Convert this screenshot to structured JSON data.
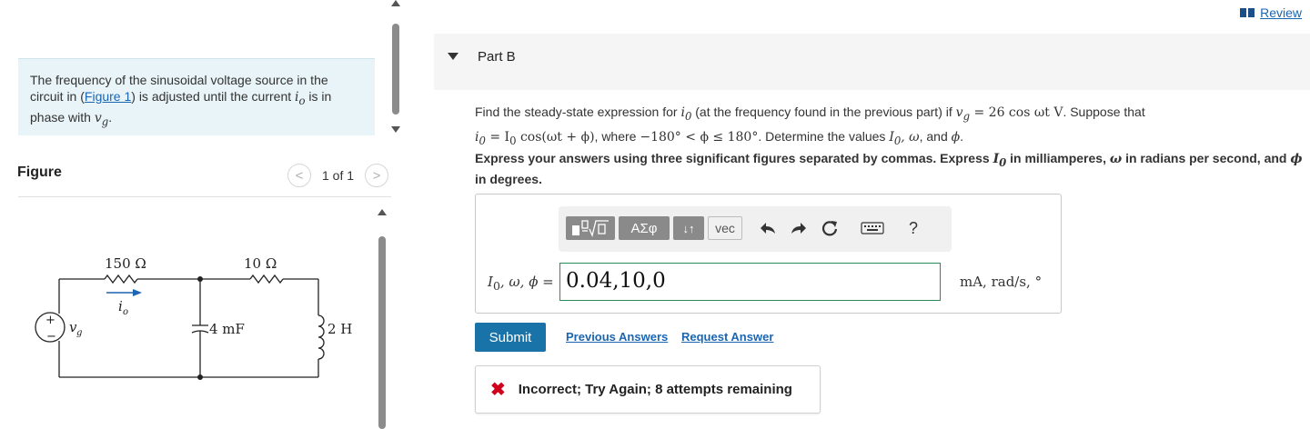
{
  "problem": {
    "text_before_link": "The frequency of the sinusoidal voltage source in the circuit in (",
    "link": "Figure 1",
    "text_after_link": ") is adjusted until the current ",
    "current_var": "i",
    "current_sub": "o",
    "text_mid": " is in phase with ",
    "voltage_var": "v",
    "voltage_sub": "g",
    "text_end": "."
  },
  "figure": {
    "title": "Figure",
    "pager_text": "1 of 1",
    "prev_glyph": "<",
    "next_glyph": ">",
    "circuit": {
      "r1": "150 Ω",
      "r2": "10 Ω",
      "capacitor": "4 mF",
      "inductor": "2 H",
      "current": "i",
      "current_sub": "o",
      "source": "v",
      "source_sub": "g",
      "plus": "+",
      "minus": "−"
    }
  },
  "review": {
    "label": "Review"
  },
  "part": {
    "title": "Part B"
  },
  "question": {
    "t1": "Find the steady-state expression for ",
    "io": "i",
    "io_sub": "0",
    "t2": " (at the frequency found in the previous part) if ",
    "vg_eq": "v",
    "vg_sub": "g",
    "vg_rhs": " = 26 cos ωt V",
    "t3": ". Suppose that",
    "line2_lhs": "i",
    "line2_lhs_sub": "0",
    "line2_rhs": " = I",
    "line2_rhs_sub": "0",
    "line2_rest": " cos(ωt + ϕ)",
    "t4": ", where ",
    "range": "−180° < ϕ ≤ 180°",
    "t5": ". Determine the values ",
    "vals": "I",
    "vals_sub": "0",
    "vals_rest": ", ω",
    "t6": ", and ",
    "phi": "ϕ",
    "t7": "."
  },
  "instructions": {
    "t1": "Express your answers using three significant figures separated by commas. Express ",
    "I0": "I",
    "I0_sub": "0",
    "t2": " in milliamperes, ",
    "omega": "ω",
    "t3": " in radians per second, and ",
    "phi": "ϕ",
    "t4": " in degrees."
  },
  "answer": {
    "label": "I",
    "label_sub": "0",
    "label_rest": ", ω, ϕ =",
    "value": "0.04,10,0",
    "units": "mA, rad/s, °"
  },
  "toolbar": {
    "greek_label": "ΑΣφ",
    "arrows_label": "↓↑",
    "vec_label": "vec",
    "help_label": "?"
  },
  "actions": {
    "submit": "Submit",
    "previous_answers": "Previous Answers",
    "request_answer": "Request Answer"
  },
  "feedback": {
    "icon": "✖",
    "message": "Incorrect; Try Again; 8 attempts remaining"
  },
  "colors": {
    "accent": "#1a73a8",
    "link": "#1a66b3",
    "error": "#d0021b",
    "problem_bg": "#e8f4f8",
    "input_border": "#2e8b57"
  }
}
